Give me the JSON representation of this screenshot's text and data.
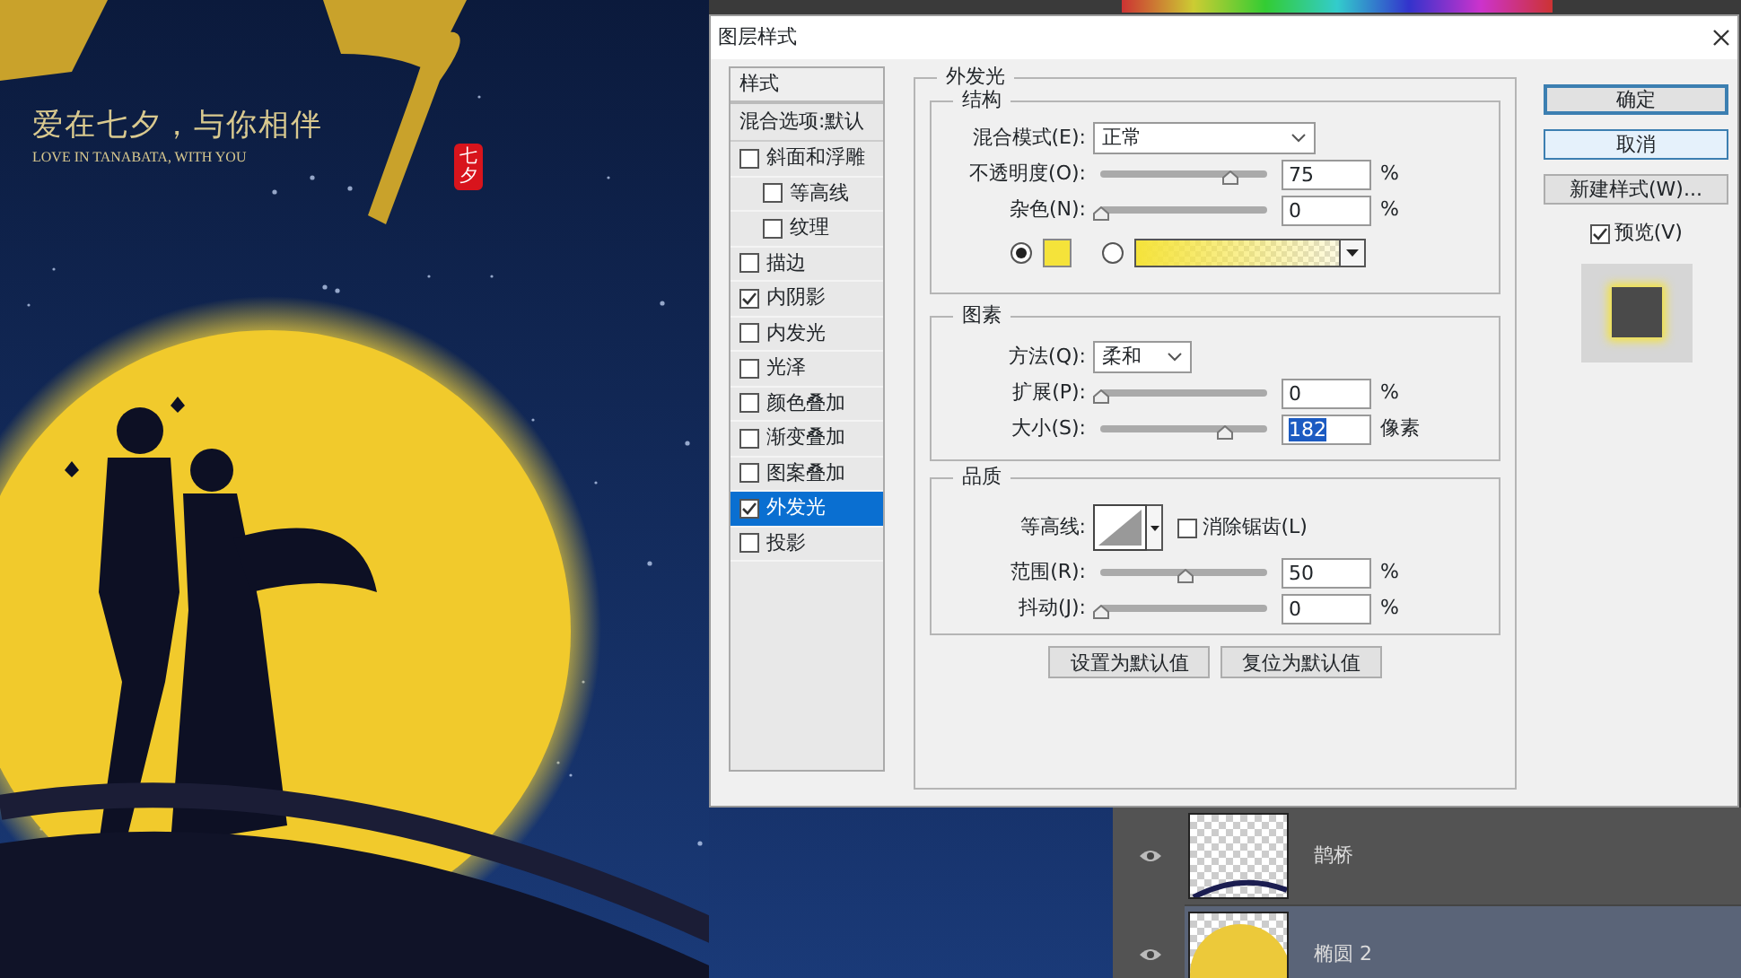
{
  "poster": {
    "tagline": "爱在七夕，与你相伴",
    "subtitle": "LOVE IN TANABATA, WITH YOU",
    "seal": "七夕"
  },
  "dialog": {
    "title": "图层样式",
    "styles_header": "样式",
    "blend_options": "混合选项:默认",
    "styles": [
      {
        "label": "斜面和浮雕",
        "checked": false,
        "selected": false,
        "children": [
          {
            "label": "等高线",
            "checked": false,
            "selected": false
          },
          {
            "label": "纹理",
            "checked": false,
            "selected": false
          }
        ]
      },
      {
        "label": "描边",
        "checked": false,
        "selected": false
      },
      {
        "label": "内阴影",
        "checked": true,
        "selected": false
      },
      {
        "label": "内发光",
        "checked": false,
        "selected": false
      },
      {
        "label": "光泽",
        "checked": false,
        "selected": false
      },
      {
        "label": "颜色叠加",
        "checked": false,
        "selected": false
      },
      {
        "label": "渐变叠加",
        "checked": false,
        "selected": false
      },
      {
        "label": "图案叠加",
        "checked": false,
        "selected": false
      },
      {
        "label": "外发光",
        "checked": true,
        "selected": true
      },
      {
        "label": "投影",
        "checked": false,
        "selected": false
      }
    ],
    "panel": {
      "title": "外发光",
      "structure": {
        "title": "结构",
        "blend_mode": {
          "label": "混合模式(E):",
          "value": "正常"
        },
        "opacity": {
          "label": "不透明度(O):",
          "level": 0.77,
          "value": "75",
          "unit": "%"
        },
        "noise": {
          "label": "杂色(N):",
          "level": 0,
          "value": "0",
          "unit": "%"
        },
        "color_modes": [
          {
            "kind": "swatch",
            "selected": true,
            "color": "#f5e33a"
          },
          {
            "kind": "gradient",
            "selected": false,
            "color": "#f5e33a"
          }
        ]
      },
      "elements": {
        "title": "图素",
        "technique": {
          "label": "方法(Q):",
          "value": "柔和"
        },
        "spread": {
          "label": "扩展(P):",
          "level": 0,
          "value": "0",
          "unit": "%",
          "highlighted": false
        },
        "size": {
          "label": "大小(S):",
          "level": 0.74,
          "value": "182",
          "unit": "像素",
          "highlighted": true
        }
      },
      "quality": {
        "title": "品质",
        "contour": {
          "label": "等高线:"
        },
        "anti_alias": {
          "label": "消除锯齿(L)",
          "checked": false
        },
        "range": {
          "label": "范围(R):",
          "level": 0.5,
          "value": "50",
          "unit": "%"
        },
        "jitter": {
          "label": "抖动(J):",
          "level": 0,
          "value": "0",
          "unit": "%"
        }
      },
      "buttons": [
        "设置为默认值",
        "复位为默认值"
      ]
    },
    "actions": [
      {
        "label": "确定",
        "default": true,
        "hovered": false
      },
      {
        "label": "取消",
        "default": false,
        "hovered": true
      },
      {
        "label": "新建样式(W)...",
        "default": false,
        "hovered": false
      }
    ],
    "preview": {
      "label": "预览(V)",
      "checked": true
    }
  },
  "layers": [
    {
      "name": "鹊桥",
      "kind": "bridge",
      "selected": false
    },
    {
      "name": "椭圆 2",
      "kind": "ellipse",
      "selected": true
    }
  ]
}
